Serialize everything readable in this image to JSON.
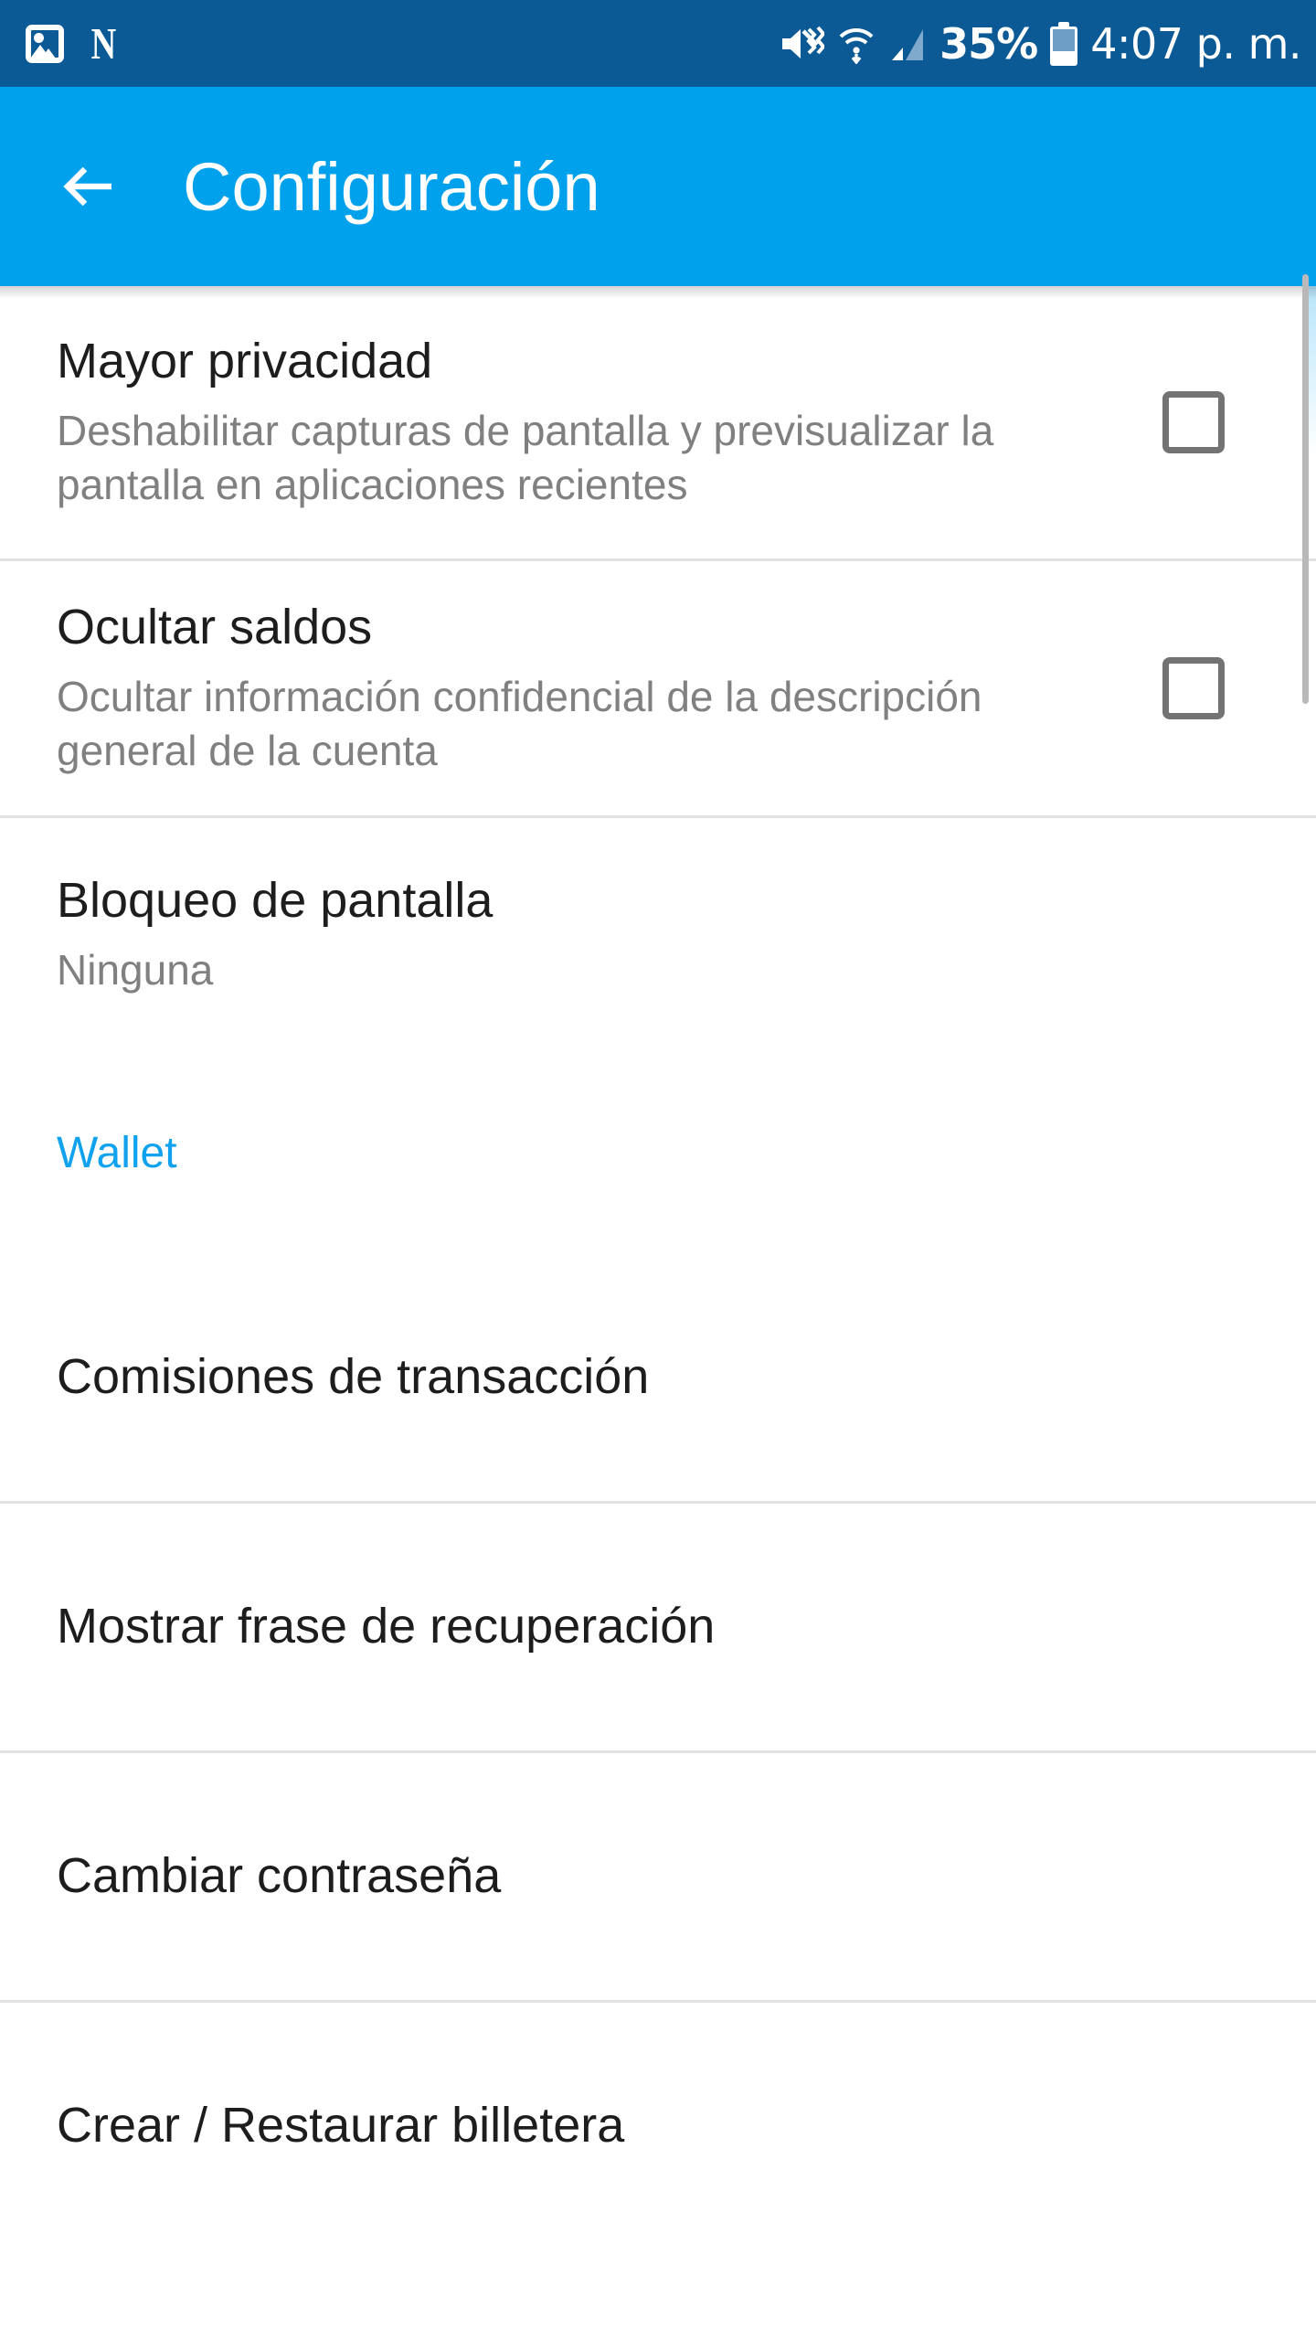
{
  "status_bar": {
    "background_color": "#0b5a96",
    "left_icons": [
      {
        "name": "screenshot-icon",
        "glyph": "image"
      },
      {
        "name": "netflix-icon",
        "glyph": "N"
      }
    ],
    "right_icons": [
      {
        "name": "volume-mute-vibrate-icon"
      },
      {
        "name": "wifi-icon"
      },
      {
        "name": "cellular-signal-icon"
      }
    ],
    "battery_percent": "35%",
    "battery_level": 35,
    "time": "4:07 p. m."
  },
  "app_bar": {
    "background_color": "#00a1ec",
    "back_label": "back-arrow",
    "title": "Configuración"
  },
  "settings": {
    "privacy": {
      "title": "Mayor privacidad",
      "description": "Deshabilitar capturas de pantalla y previsualizar la pantalla en aplicaciones recientes",
      "checked": false
    },
    "hide_balances": {
      "title": "Ocultar saldos",
      "description": "Ocultar información confidencial de la descripción general de la cuenta",
      "checked": false
    },
    "screen_lock": {
      "title": "Bloqueo de pantalla",
      "value": "Ninguna"
    }
  },
  "wallet_section": {
    "header": "Wallet",
    "header_color": "#11a2ef",
    "items": [
      {
        "label": "Comisiones de transacción"
      },
      {
        "label": "Mostrar frase de recuperación"
      },
      {
        "label": "Cambiar contraseña"
      },
      {
        "label": "Crear / Restaurar billetera"
      }
    ]
  }
}
